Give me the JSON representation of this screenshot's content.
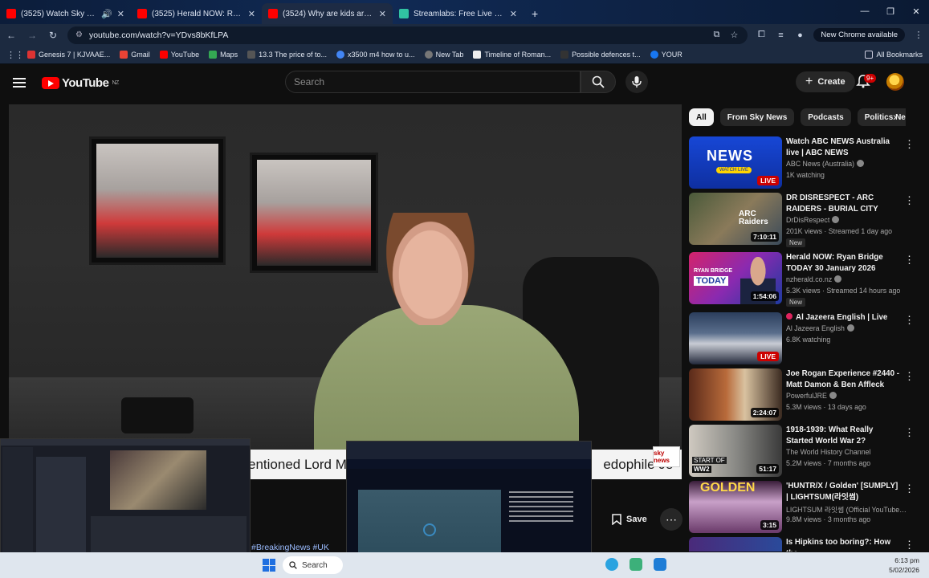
{
  "browser": {
    "tabs": [
      {
        "title": "(3525) Watch Sky News - Yo",
        "color": "#ff0000",
        "active": false,
        "audio": true
      },
      {
        "title": "(3525) Herald NOW: Ryan Bridg",
        "color": "#ff0000",
        "active": false
      },
      {
        "title": "(3524) Why are kids are still go",
        "color": "#ff0000",
        "active": true
      },
      {
        "title": "Streamlabs: Free Live Streaming",
        "color": "#31c3a2",
        "active": false
      }
    ],
    "url": "youtube.com/watch?v=YDvs8bKfLPA",
    "new_chrome_label": "New Chrome available",
    "bookmarks": [
      {
        "label": "Genesis 7 | KJVAAE...",
        "color": "#d33"
      },
      {
        "label": "Gmail",
        "color": "#ea4335"
      },
      {
        "label": "YouTube",
        "color": "#ff0000"
      },
      {
        "label": "Maps",
        "color": "#34a853"
      },
      {
        "label": "13.3 The price of to...",
        "color": "#555"
      },
      {
        "label": "x3500 m4 how to u...",
        "color": "#4285f4"
      },
      {
        "label": "New Tab",
        "color": "#777"
      },
      {
        "label": "Timeline of Roman...",
        "color": "#eee"
      },
      {
        "label": "Possible defences t...",
        "color": "#333"
      },
      {
        "label": "YOUR",
        "color": "#1877f2"
      }
    ],
    "all_bookmarks": "All Bookmarks"
  },
  "youtube": {
    "logo_text": "YouTube",
    "region": "NZ",
    "search_placeholder": "Search",
    "create_label": "Create",
    "notif_count": "9+",
    "video": {
      "ticker_text": "entioned Lord Ma",
      "ticker_text2": "edophile Je",
      "save_label": "Save",
      "hashtag": "#BreakingNews #UK",
      "sky_label": "sky news"
    },
    "chips": [
      {
        "label": "All",
        "active": true
      },
      {
        "label": "From Sky News",
        "active": false
      },
      {
        "label": "Podcasts",
        "active": false
      },
      {
        "label": "Politics Ne",
        "active": false
      }
    ],
    "recs": [
      {
        "title": "Watch ABC NEWS Australia live | ABC NEWS",
        "channel": "ABC News (Australia)",
        "meta": "1K watching",
        "badge": "LIVE",
        "is_new": false,
        "thumb": "abc"
      },
      {
        "title": "DR DISRESPECT - ARC RAIDERS - BURIAL CITY KILLAS",
        "channel": "DrDisRespect",
        "meta": "201K views · Streamed 1 day ago",
        "badge": "7:10:11",
        "is_new": true,
        "thumb": "arc"
      },
      {
        "title": "Herald NOW: Ryan Bridge TODAY 30 January 2026",
        "channel": "nzherald.co.nz",
        "meta": "5.3K views · Streamed 14 hours ago",
        "badge": "1:54:06",
        "is_new": true,
        "thumb": "ryan"
      },
      {
        "title": "Al Jazeera English | Live",
        "channel": "Al Jazeera English",
        "meta": "6.8K watching",
        "badge": "LIVE",
        "is_new": false,
        "thumb": "aj"
      },
      {
        "title": "Joe Rogan Experience #2440 - Matt Damon & Ben Affleck",
        "channel": "PowerfulJRE",
        "meta": "5.3M views · 13 days ago",
        "badge": "2:24:07",
        "is_new": false,
        "thumb": "jre"
      },
      {
        "title": "1918-1939: What Really Started World War 2?",
        "channel": "The World History Channel",
        "meta": "5.2M views · 7 months ago",
        "badge": "51:17",
        "is_new": false,
        "thumb": "ww2"
      },
      {
        "title": "'HUNTR/X / Golden' [SUMPLY] | LIGHTSUM(라잇썸)",
        "channel": "LIGHTSUM 라잇썸 (Official YouTube Cha...",
        "meta": "9.8M views · 3 months ago",
        "badge": "3:15",
        "is_new": false,
        "thumb": "golden"
      },
      {
        "title": "Is Hipkins too boring?: How the",
        "channel": "",
        "meta": "",
        "badge": "",
        "is_new": false,
        "thumb": "hip"
      }
    ]
  },
  "taskbar": {
    "search_label": "Search",
    "time": "6:13 pm",
    "date": "5/02/2026"
  },
  "thumb_labels": {
    "abc_name": "NEWS",
    "abc_sub": "WATCH LIVE",
    "arc_logo": "ARC Raiders",
    "ryan": "RYAN BRIDGE",
    "today": "TODAY",
    "ww2_a": "START OF",
    "ww2_b": "WW2",
    "golden": "GOLDEN"
  },
  "new_label": "New"
}
